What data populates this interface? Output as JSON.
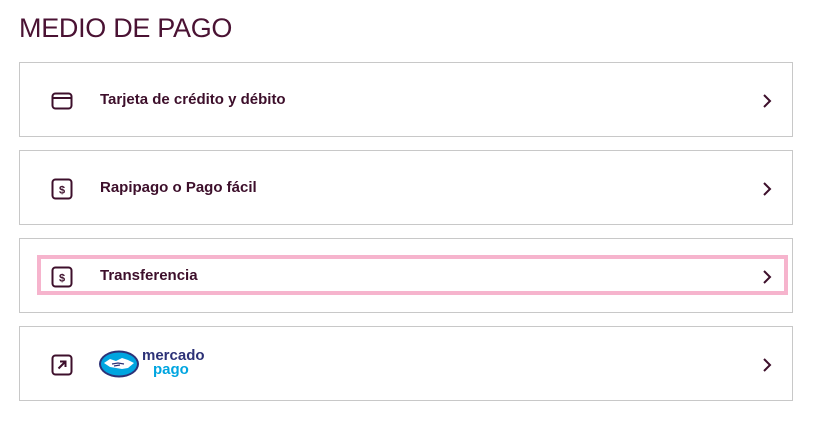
{
  "page": {
    "title": "MEDIO DE PAGO"
  },
  "options": [
    {
      "label": "Tarjeta de crédito y débito",
      "icon": "credit-card-icon",
      "selected": false
    },
    {
      "label": "Rapipago o Pago fácil",
      "icon": "dollar-badge-icon",
      "selected": false
    },
    {
      "label": "Transferencia",
      "icon": "dollar-badge-icon",
      "selected": true
    },
    {
      "label": "",
      "icon": "external-link-icon",
      "selected": false,
      "logo": {
        "line1": "mercado",
        "line2": "pago",
        "icon": "handshake-icon"
      }
    }
  ],
  "colors": {
    "text": "#3d0f2b",
    "border": "#c8c8c8",
    "selected_outline": "#f6b4cd",
    "mp_navy": "#2d3277",
    "mp_blue": "#00a5e0"
  }
}
